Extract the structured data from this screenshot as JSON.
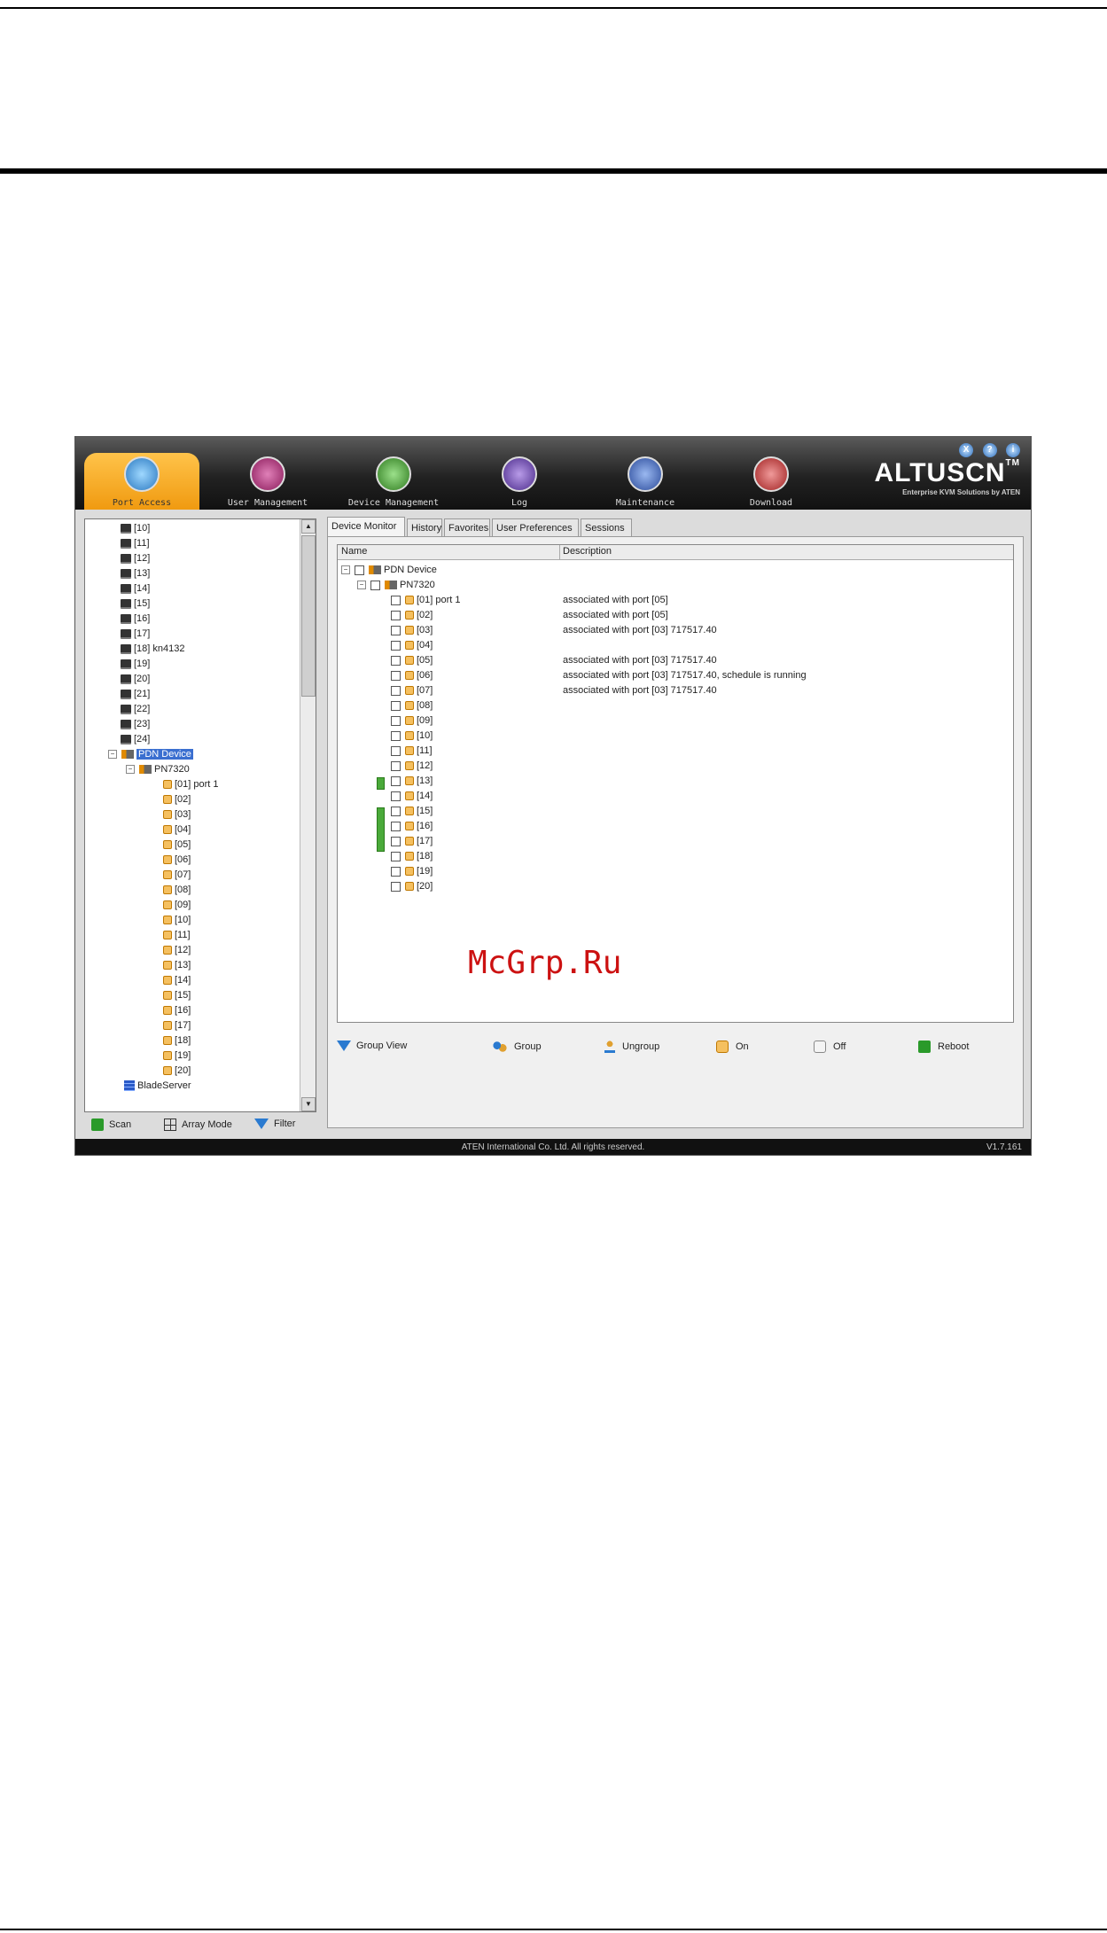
{
  "watermark": "McGrp.Ru",
  "app": {
    "nav": [
      {
        "label": "Port Access",
        "icon": "port-access-icon"
      },
      {
        "label": "User Management",
        "icon": "user-management-icon"
      },
      {
        "label": "Device Management",
        "icon": "device-management-icon"
      },
      {
        "label": "Log",
        "icon": "log-icon"
      },
      {
        "label": "Maintenance",
        "icon": "maintenance-icon"
      },
      {
        "label": "Download",
        "icon": "download-icon"
      }
    ],
    "window_icons": [
      "X",
      "?",
      "i"
    ],
    "brand": {
      "name": "ALTUSCN",
      "tm": "TM",
      "tagline": "Enterprise KVM Solutions by ATEN"
    },
    "left_tree": {
      "ports": [
        "[10]",
        "[11]",
        "[12]",
        "[13]",
        "[14]",
        "[15]",
        "[16]",
        "[17]",
        "[18] kn4132",
        "[19]",
        "[20]",
        "[21]",
        "[22]",
        "[23]",
        "[24]"
      ],
      "pdu_device": "PDN Device",
      "pdu_model": "PN7320",
      "outlets": [
        "[01] port 1",
        "[02]",
        "[03]",
        "[04]",
        "[05]",
        "[06]",
        "[07]",
        "[08]",
        "[09]",
        "[10]",
        "[11]",
        "[12]",
        "[13]",
        "[14]",
        "[15]",
        "[16]",
        "[17]",
        "[18]",
        "[19]",
        "[20]"
      ],
      "blade": "BladeServer"
    },
    "left_footer": {
      "scan": "Scan",
      "array_mode": "Array Mode",
      "filter": "Filter"
    },
    "tabs": [
      "Device Monitor",
      "History",
      "Favorites",
      "User Preferences",
      "Sessions"
    ],
    "grid": {
      "col_name": "Name",
      "col_desc": "Description",
      "device": "PDN Device",
      "model": "PN7320",
      "outlets": [
        {
          "name": "[01] port 1",
          "desc": "associated with port [05]"
        },
        {
          "name": "[02]",
          "desc": "associated with port [05]"
        },
        {
          "name": "[03]",
          "desc": "associated with port [03] 717517.40"
        },
        {
          "name": "[04]",
          "desc": ""
        },
        {
          "name": "[05]",
          "desc": "associated with port [03] 717517.40"
        },
        {
          "name": "[06]",
          "desc": "associated with port [03] 717517.40, schedule is running"
        },
        {
          "name": "[07]",
          "desc": "associated with port [03] 717517.40"
        },
        {
          "name": "[08]",
          "desc": ""
        },
        {
          "name": "[09]",
          "desc": ""
        },
        {
          "name": "[10]",
          "desc": ""
        },
        {
          "name": "[11]",
          "desc": ""
        },
        {
          "name": "[12]",
          "desc": ""
        },
        {
          "name": "[13]",
          "desc": ""
        },
        {
          "name": "[14]",
          "desc": ""
        },
        {
          "name": "[15]",
          "desc": ""
        },
        {
          "name": "[16]",
          "desc": ""
        },
        {
          "name": "[17]",
          "desc": ""
        },
        {
          "name": "[18]",
          "desc": ""
        },
        {
          "name": "[19]",
          "desc": ""
        },
        {
          "name": "[20]",
          "desc": ""
        }
      ]
    },
    "toolbar": {
      "group_view": "Group View",
      "group": "Group",
      "ungroup": "Ungroup",
      "on": "On",
      "off": "Off",
      "reboot": "Reboot"
    },
    "status": {
      "copyright": "ATEN International Co. Ltd. All rights reserved.",
      "version": "V1.7.161"
    },
    "colors": {
      "accent": "#f09a10",
      "selection": "#3a6fd0",
      "group_tag": "#4aaa3a"
    }
  }
}
